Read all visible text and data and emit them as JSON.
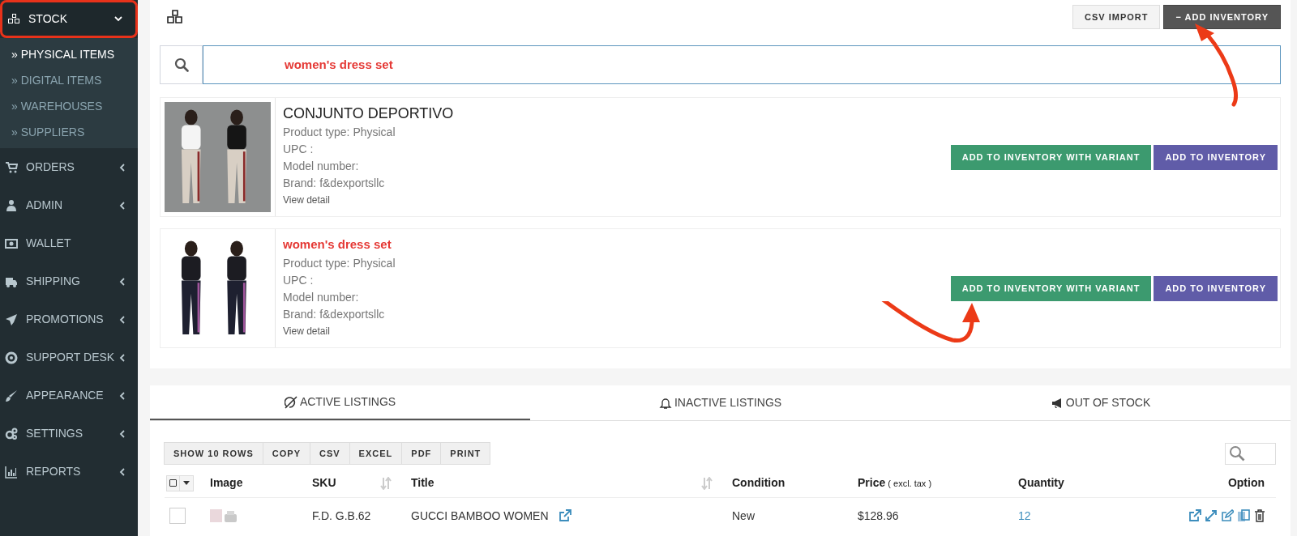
{
  "sidebar": {
    "items": [
      {
        "label": "STOCK",
        "kind": "group",
        "expanded": true,
        "selected": true,
        "children": [
          {
            "label": "» PHYSICAL ITEMS",
            "selected": true
          },
          {
            "label": "» DIGITAL ITEMS",
            "selected": false
          },
          {
            "label": "» WAREHOUSES",
            "selected": false
          },
          {
            "label": "» SUPPLIERS",
            "selected": false
          }
        ]
      },
      {
        "label": "ORDERS",
        "kind": "group",
        "expanded": false,
        "selected": false
      },
      {
        "label": "ADMIN",
        "kind": "group",
        "expanded": false,
        "selected": false
      },
      {
        "label": "WALLET",
        "kind": "link",
        "selected": false
      },
      {
        "label": "SHIPPING",
        "kind": "group",
        "expanded": false,
        "selected": false
      },
      {
        "label": "PROMOTIONS",
        "kind": "group",
        "expanded": false,
        "selected": false
      },
      {
        "label": "SUPPORT DESK",
        "kind": "group",
        "expanded": false,
        "selected": false
      },
      {
        "label": "APPEARANCE",
        "kind": "group",
        "expanded": false,
        "selected": false
      },
      {
        "label": "SETTINGS",
        "kind": "group",
        "expanded": false,
        "selected": false
      },
      {
        "label": "REPORTS",
        "kind": "group",
        "expanded": false,
        "selected": false
      }
    ]
  },
  "header": {
    "buttons": [
      {
        "label": "CSV IMPORT",
        "kind": "light"
      },
      {
        "label": "− ADD INVENTORY",
        "kind": "dark"
      }
    ]
  },
  "search": {
    "value": "women's dress set"
  },
  "products": [
    {
      "title": "CONJUNTO DEPORTIVO",
      "kind": "plain",
      "details": [
        "Product type: Physical",
        "UPC :",
        "Model number:",
        "Brand: f&dexportsllc"
      ],
      "link": "View detail",
      "buttons": [
        {
          "label": "ADD TO INVENTORY WITH VARIANT",
          "kind": "variant"
        },
        {
          "label": "ADD TO INVENTORY",
          "kind": "add"
        }
      ]
    },
    {
      "title": "women's dress set",
      "kind": "annotated",
      "details": [
        "Product type: Physical",
        "UPC :",
        "Model number:",
        "Brand: f&dexportsllc"
      ],
      "link": "View detail",
      "buttons": [
        {
          "label": "ADD TO INVENTORY WITH VARIANT",
          "kind": "variant"
        },
        {
          "label": "ADD TO INVENTORY",
          "kind": "add"
        }
      ]
    }
  ],
  "tabs": [
    {
      "label": "ACTIVE LISTINGS",
      "selected": true
    },
    {
      "label": "INACTIVE LISTINGS",
      "selected": false
    },
    {
      "label": "OUT OF STOCK",
      "selected": false
    }
  ],
  "table": {
    "toolbar": [
      "SHOW 10 ROWS",
      "COPY",
      "CSV",
      "EXCEL",
      "PDF",
      "PRINT"
    ],
    "columns": [
      {
        "label": "Image",
        "sortable": false
      },
      {
        "label": "SKU",
        "sortable": true
      },
      {
        "label": "Title",
        "sortable": true
      },
      {
        "label": "Condition",
        "sortable": false
      },
      {
        "label": "Price",
        "note": "( excl. tax )",
        "sortable": false
      },
      {
        "label": "Quantity",
        "sortable": false
      },
      {
        "label": "Option",
        "sortable": false
      }
    ],
    "rows": [
      {
        "checked": false,
        "sku": "F.D. G.B.62",
        "title": "GUCCI BAMBOO WOMEN",
        "condition": "New",
        "price": "$128.96",
        "quantity": "12"
      }
    ]
  }
}
